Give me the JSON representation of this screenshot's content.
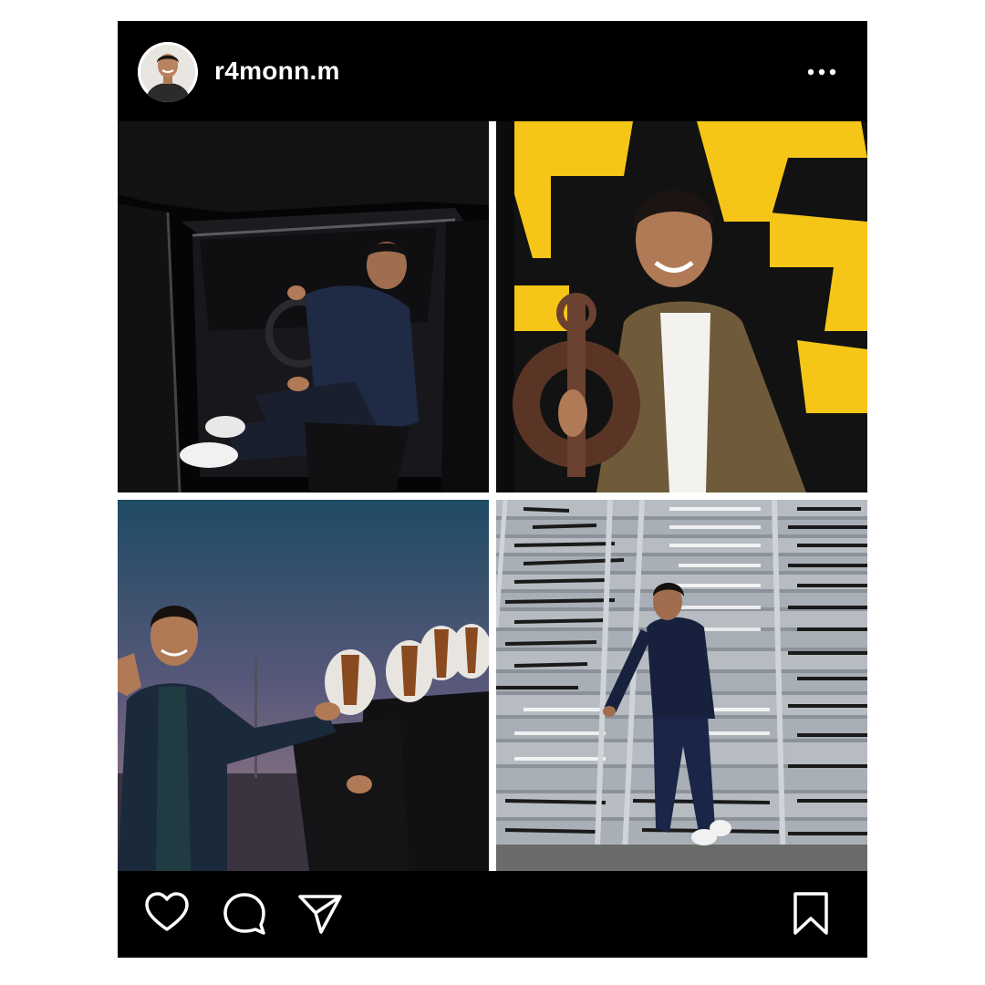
{
  "post": {
    "username": "r4monn.m",
    "avatar_icon": "profile-photo",
    "menu_icon": "more-options-icon"
  },
  "photos": [
    {
      "id": "car-photo",
      "description_icon": "image-photo"
    },
    {
      "id": "award-photo",
      "description_icon": "image-photo"
    },
    {
      "id": "group-photo",
      "description_icon": "image-photo"
    },
    {
      "id": "stairs-photo",
      "description_icon": "image-photo"
    }
  ],
  "actions": {
    "like_icon": "heart-icon",
    "comment_icon": "comment-icon",
    "share_icon": "send-icon",
    "save_icon": "bookmark-icon"
  },
  "colors": {
    "frame": "#000000",
    "background": "#ffffff",
    "text": "#ffffff",
    "sign_yellow": "#f5c518"
  }
}
